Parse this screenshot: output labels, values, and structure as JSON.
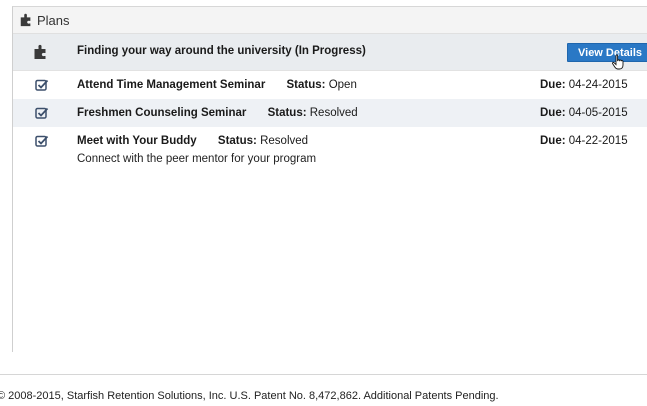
{
  "panel": {
    "title": "Plans",
    "header_icon": "puzzle-icon"
  },
  "plan": {
    "title": "Finding your way around the university (In Progress)",
    "icon": "puzzle-icon",
    "view_button_label": "View Details"
  },
  "tasks": [
    {
      "name": "Attend Time Management Seminar",
      "status_label": "Status:",
      "status": "Open",
      "due_label": "Due:",
      "due": "04-24-2015",
      "description": "",
      "icon": "checkbox-checked-icon"
    },
    {
      "name": "Freshmen Counseling Seminar",
      "status_label": "Status:",
      "status": "Resolved",
      "due_label": "Due:",
      "due": "04-05-2015",
      "description": "",
      "icon": "checkbox-checked-icon"
    },
    {
      "name": "Meet with Your Buddy",
      "status_label": "Status:",
      "status": "Resolved",
      "due_label": "Due:",
      "due": "04-22-2015",
      "description": "Connect with the peer mentor for your program",
      "icon": "checkbox-checked-icon"
    }
  ],
  "footer": {
    "text": "© 2008-2015, Starfish Retention Solutions, Inc. U.S. Patent No. 8,472,862. Additional Patents Pending."
  },
  "colors": {
    "button_bg": "#2a78c5",
    "header_bg": "#f4f4f4",
    "plan_row_bg": "#e9ecef",
    "alt_row_bg": "#eef1f5"
  }
}
